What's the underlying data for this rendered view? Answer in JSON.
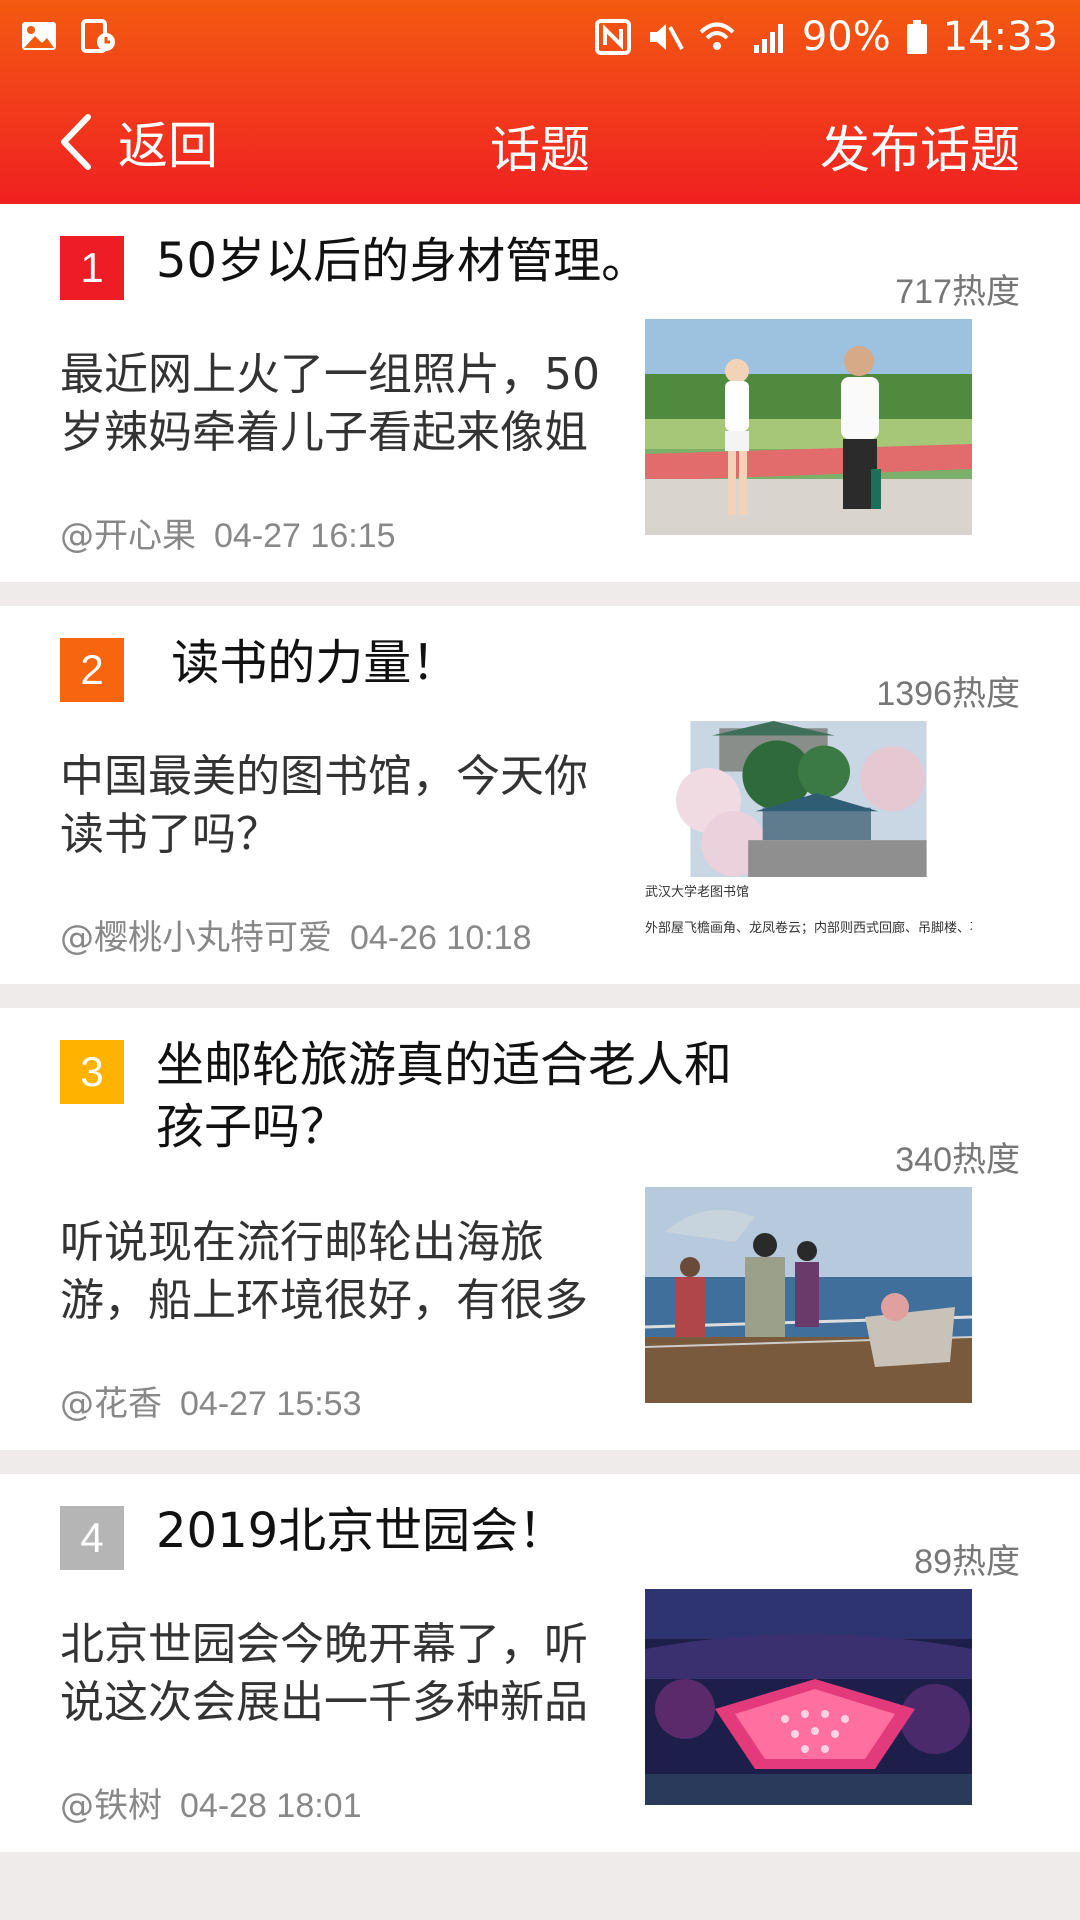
{
  "status_bar": {
    "battery": "90%",
    "time": "14:33",
    "left_icons": [
      "gallery-icon",
      "clock-app-icon"
    ],
    "right_icons": [
      "nfc-icon",
      "mute-icon",
      "wifi-icon",
      "signal-icon",
      "battery-icon"
    ]
  },
  "nav": {
    "back_label": "返回",
    "title": "话题",
    "publish_label": "发布话题"
  },
  "colors": {
    "header_top": "#f35a10",
    "header_bottom": "#ef2020",
    "rank_1": "#ee1c24",
    "rank_2": "#f7650f",
    "rank_3": "#ffb300",
    "rank_4": "#b5b5b5"
  },
  "topics": [
    {
      "rank": "1",
      "title": "50岁以后的身材管理。",
      "heat": "717热度",
      "summary": "最近网上火了一组照片，50岁辣妈牵着儿子看起来像姐",
      "author": "@开心果",
      "date": "04-27 16:15",
      "image": "photo-couple-walking"
    },
    {
      "rank": "2",
      "title": " 读书的力量！",
      "heat": "1396热度",
      "summary": "中国最美的图书馆，今天你读书了吗？",
      "author": "@樱桃小丸特可爱",
      "date": "04-26 10:18",
      "image": "photo-library",
      "image_caption_1": "武汉大学老图书馆",
      "image_caption_2": "外部屋飞檐画角、龙凤卷云；内部则西式回廊、吊脚楼、石"
    },
    {
      "rank": "3",
      "title": "坐邮轮旅游真的适合老人和孩子吗？",
      "heat": "340热度",
      "summary": "听说现在流行邮轮出海旅游，船上环境很好，有很多",
      "author": "@花香",
      "date": "04-27 15:53",
      "image": "photo-cruise-deck"
    },
    {
      "rank": "4",
      "title": "2019北京世园会！",
      "heat": "89热度",
      "summary": "北京世园会今晚开幕了，听说这次会展出一千多种新品",
      "author": "@铁树",
      "date": "04-28 18:01",
      "image": "photo-expo-night"
    }
  ]
}
